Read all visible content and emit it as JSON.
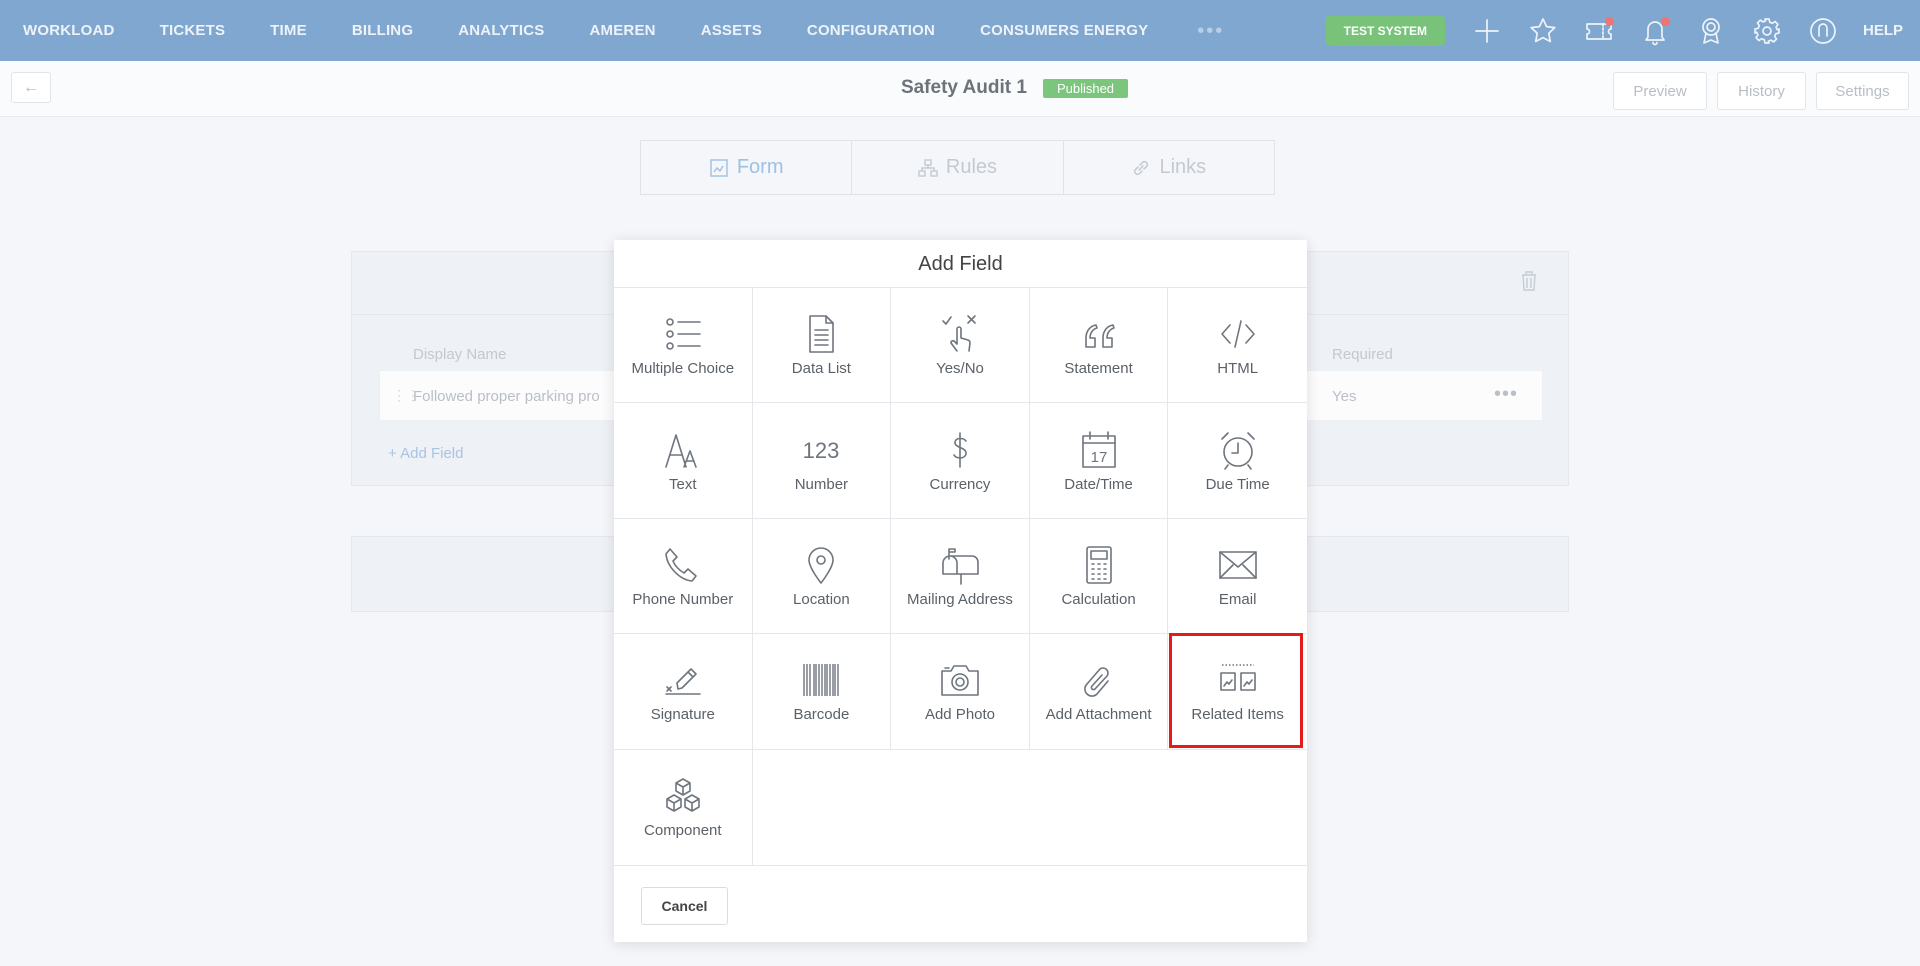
{
  "nav": {
    "items": [
      "WORKLOAD",
      "TICKETS",
      "TIME",
      "BILLING",
      "ANALYTICS",
      "AMEREN",
      "ASSETS",
      "CONFIGURATION",
      "CONSUMERS ENERGY"
    ],
    "more": "•••",
    "test_badge": "TEST SYSTEM",
    "help": "HELP"
  },
  "header": {
    "title": "Safety Audit 1",
    "status": "Published",
    "buttons": [
      "Preview",
      "History",
      "Settings"
    ]
  },
  "tabs": [
    "Form",
    "Rules",
    "Links"
  ],
  "table": {
    "col_display": "Display Name",
    "col_required": "Required",
    "row_name": "Followed proper parking pro",
    "row_required": "Yes",
    "row_more": "•••",
    "add_field": "+ Add Field"
  },
  "modal": {
    "title": "Add Field",
    "fields": [
      {
        "label": "Multiple Choice",
        "icon": "list-icon"
      },
      {
        "label": "Data List",
        "icon": "document-icon"
      },
      {
        "label": "Yes/No",
        "icon": "check-x-icon"
      },
      {
        "label": "Statement",
        "icon": "quote-icon"
      },
      {
        "label": "HTML",
        "icon": "code-icon"
      },
      {
        "label": "Text",
        "icon": "text-icon"
      },
      {
        "label": "Number",
        "icon": "number-icon"
      },
      {
        "label": "Currency",
        "icon": "dollar-icon"
      },
      {
        "label": "Date/Time",
        "icon": "calendar-icon"
      },
      {
        "label": "Due Time",
        "icon": "alarm-clock-icon"
      },
      {
        "label": "Phone Number",
        "icon": "phone-icon"
      },
      {
        "label": "Location",
        "icon": "map-pin-icon"
      },
      {
        "label": "Mailing Address",
        "icon": "mailbox-icon"
      },
      {
        "label": "Calculation",
        "icon": "calculator-icon"
      },
      {
        "label": "Email",
        "icon": "envelope-icon"
      },
      {
        "label": "Signature",
        "icon": "signature-icon"
      },
      {
        "label": "Barcode",
        "icon": "barcode-icon"
      },
      {
        "label": "Add Photo",
        "icon": "camera-icon"
      },
      {
        "label": "Add Attachment",
        "icon": "paperclip-icon"
      },
      {
        "label": "Related Items",
        "icon": "related-items-icon"
      },
      {
        "label": "Component",
        "icon": "cubes-icon"
      }
    ],
    "number_glyph": "123",
    "calendar_day": "17",
    "cancel": "Cancel"
  }
}
